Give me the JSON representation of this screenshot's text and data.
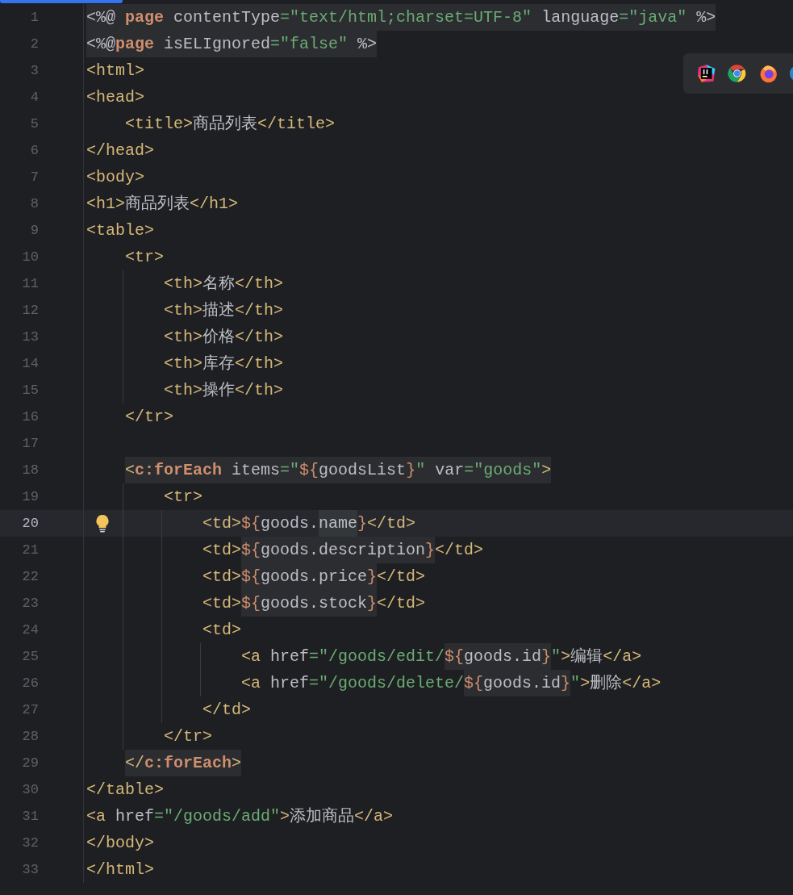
{
  "editor": {
    "lines": [
      {
        "n": "1",
        "selected": false,
        "segments": [
          {
            "kind": "block",
            "tokens": [
              {
                "kind": "plain",
                "text": "<%@ "
              },
              {
                "kind": "keyword",
                "text": "page"
              },
              {
                "kind": "plain",
                "text": " contentType"
              },
              {
                "kind": "string",
                "text": "=\"text/html;charset=UTF-8\""
              },
              {
                "kind": "plain",
                "text": " language"
              },
              {
                "kind": "string",
                "text": "=\"java\""
              },
              {
                "kind": "plain",
                "text": " %>"
              }
            ]
          }
        ]
      },
      {
        "n": "2",
        "selected": false,
        "segments": [
          {
            "kind": "block",
            "tokens": [
              {
                "kind": "plain",
                "text": "<%@"
              },
              {
                "kind": "keyword",
                "text": "page"
              },
              {
                "kind": "plain",
                "text": " isELIgnored"
              },
              {
                "kind": "string",
                "text": "=\"false\""
              },
              {
                "kind": "plain",
                "text": " %>"
              }
            ]
          }
        ]
      },
      {
        "n": "3",
        "selected": false,
        "segments": [
          {
            "kind": "plain",
            "tokens": [
              {
                "kind": "tag",
                "text": "<html>"
              }
            ]
          }
        ]
      },
      {
        "n": "4",
        "selected": false,
        "segments": [
          {
            "kind": "plain",
            "tokens": [
              {
                "kind": "tag",
                "text": "<head>"
              }
            ]
          }
        ],
        "children": [
          {
            "n": "5",
            "selected": false,
            "segments": [
              {
                "kind": "plain",
                "tokens": [
                  {
                    "kind": "tag",
                    "text": "<title>"
                  },
                  {
                    "kind": "plain",
                    "text": "商品列表"
                  },
                  {
                    "kind": "tag",
                    "text": "</title>"
                  }
                ]
              }
            ]
          }
        ]
      },
      {
        "n": "6",
        "selected": false,
        "segments": [
          {
            "kind": "plain",
            "tokens": [
              {
                "kind": "tag",
                "text": "</head>"
              }
            ]
          }
        ]
      },
      {
        "n": "7",
        "selected": false,
        "segments": [
          {
            "kind": "plain",
            "tokens": [
              {
                "kind": "tag",
                "text": "<body>"
              }
            ]
          }
        ]
      },
      {
        "n": "8",
        "selected": false,
        "segments": [
          {
            "kind": "plain",
            "tokens": [
              {
                "kind": "tag",
                "text": "<h1>"
              },
              {
                "kind": "plain",
                "text": "商品列表"
              },
              {
                "kind": "tag",
                "text": "</h1>"
              }
            ]
          }
        ]
      },
      {
        "n": "9",
        "selected": false,
        "segments": [
          {
            "kind": "plain",
            "tokens": [
              {
                "kind": "tag",
                "text": "<table>"
              }
            ]
          }
        ],
        "children": [
          {
            "n": "10",
            "selected": false,
            "segments": [
              {
                "kind": "plain",
                "tokens": [
                  {
                    "kind": "tag",
                    "text": "<tr>"
                  }
                ]
              }
            ],
            "children": [
              {
                "n": "11",
                "selected": false,
                "segments": [
                  {
                    "kind": "plain",
                    "tokens": [
                      {
                        "kind": "tag",
                        "text": "<th>"
                      },
                      {
                        "kind": "plain",
                        "text": "名称"
                      },
                      {
                        "kind": "tag",
                        "text": "</th>"
                      }
                    ]
                  }
                ]
              },
              {
                "n": "12",
                "selected": false,
                "segments": [
                  {
                    "kind": "plain",
                    "tokens": [
                      {
                        "kind": "tag",
                        "text": "<th>"
                      },
                      {
                        "kind": "plain",
                        "text": "描述"
                      },
                      {
                        "kind": "tag",
                        "text": "</th>"
                      }
                    ]
                  }
                ]
              },
              {
                "n": "13",
                "selected": false,
                "segments": [
                  {
                    "kind": "plain",
                    "tokens": [
                      {
                        "kind": "tag",
                        "text": "<th>"
                      },
                      {
                        "kind": "plain",
                        "text": "价格"
                      },
                      {
                        "kind": "tag",
                        "text": "</th>"
                      }
                    ]
                  }
                ]
              },
              {
                "n": "14",
                "selected": false,
                "segments": [
                  {
                    "kind": "plain",
                    "tokens": [
                      {
                        "kind": "tag",
                        "text": "<th>"
                      },
                      {
                        "kind": "plain",
                        "text": "库存"
                      },
                      {
                        "kind": "tag",
                        "text": "</th>"
                      }
                    ]
                  }
                ]
              },
              {
                "n": "15",
                "selected": false,
                "segments": [
                  {
                    "kind": "plain",
                    "tokens": [
                      {
                        "kind": "tag",
                        "text": "<th>"
                      },
                      {
                        "kind": "plain",
                        "text": "操作"
                      },
                      {
                        "kind": "tag",
                        "text": "</th>"
                      }
                    ]
                  }
                ]
              }
            ]
          },
          {
            "n": "16",
            "selected": false,
            "segments": [
              {
                "kind": "plain",
                "tokens": [
                  {
                    "kind": "tag",
                    "text": "</tr>"
                  }
                ]
              }
            ]
          },
          {
            "n": "17",
            "selected": false
          },
          {
            "n": "18",
            "selected": false,
            "segments": [
              {
                "kind": "block",
                "tokens": [
                  {
                    "kind": "tag",
                    "text": "<"
                  },
                  {
                    "kind": "keyword",
                    "text": "c:forEach"
                  },
                  {
                    "kind": "plain",
                    "text": " items"
                  },
                  {
                    "kind": "string",
                    "text": "=\""
                  },
                  {
                    "kind": "el",
                    "text": "${"
                  },
                  {
                    "kind": "plain",
                    "text": "goodsList"
                  },
                  {
                    "kind": "el",
                    "text": "}"
                  },
                  {
                    "kind": "string",
                    "text": "\""
                  },
                  {
                    "kind": "plain",
                    "text": " var"
                  },
                  {
                    "kind": "string",
                    "text": "=\"goods\""
                  },
                  {
                    "kind": "tag",
                    "text": ">"
                  }
                ]
              }
            ],
            "children": [
              {
                "n": "19",
                "selected": false,
                "segments": [
                  {
                    "kind": "plain",
                    "tokens": [
                      {
                        "kind": "tag",
                        "text": "<tr>"
                      }
                    ]
                  }
                ],
                "children": [
                  {
                    "n": "20",
                    "selected": true,
                    "segments": [
                      {
                        "kind": "plain",
                        "tokens": [
                          {
                            "kind": "tag",
                            "text": "<td>"
                          },
                          {
                            "kind": "el",
                            "text": "${"
                          },
                          {
                            "kind": "plain",
                            "text": "goods."
                          }
                        ]
                      },
                      {
                        "kind": "word",
                        "tokens": [
                          {
                            "kind": "plain",
                            "text": "name"
                          }
                        ]
                      },
                      {
                        "kind": "plain",
                        "tokens": [
                          {
                            "kind": "el",
                            "text": "}"
                          },
                          {
                            "kind": "tag",
                            "text": "</td>"
                          }
                        ]
                      }
                    ]
                  },
                  {
                    "n": "21",
                    "selected": false,
                    "segments": [
                      {
                        "kind": "plain",
                        "tokens": [
                          {
                            "kind": "tag",
                            "text": "<td>"
                          }
                        ]
                      },
                      {
                        "kind": "block",
                        "tokens": [
                          {
                            "kind": "el",
                            "text": "${"
                          },
                          {
                            "kind": "plain",
                            "text": "goods.description"
                          },
                          {
                            "kind": "el",
                            "text": "}"
                          }
                        ]
                      },
                      {
                        "kind": "plain",
                        "tokens": [
                          {
                            "kind": "tag",
                            "text": "</td>"
                          }
                        ]
                      }
                    ]
                  },
                  {
                    "n": "22",
                    "selected": false,
                    "segments": [
                      {
                        "kind": "plain",
                        "tokens": [
                          {
                            "kind": "tag",
                            "text": "<td>"
                          }
                        ]
                      },
                      {
                        "kind": "block",
                        "tokens": [
                          {
                            "kind": "el",
                            "text": "${"
                          },
                          {
                            "kind": "plain",
                            "text": "goods.price"
                          },
                          {
                            "kind": "el",
                            "text": "}"
                          }
                        ]
                      },
                      {
                        "kind": "plain",
                        "tokens": [
                          {
                            "kind": "tag",
                            "text": "</td>"
                          }
                        ]
                      }
                    ]
                  },
                  {
                    "n": "23",
                    "selected": false,
                    "segments": [
                      {
                        "kind": "plain",
                        "tokens": [
                          {
                            "kind": "tag",
                            "text": "<td>"
                          }
                        ]
                      },
                      {
                        "kind": "block",
                        "tokens": [
                          {
                            "kind": "el",
                            "text": "${"
                          },
                          {
                            "kind": "plain",
                            "text": "goods.stock"
                          },
                          {
                            "kind": "el",
                            "text": "}"
                          }
                        ]
                      },
                      {
                        "kind": "plain",
                        "tokens": [
                          {
                            "kind": "tag",
                            "text": "</td>"
                          }
                        ]
                      }
                    ]
                  },
                  {
                    "n": "24",
                    "selected": false,
                    "segments": [
                      {
                        "kind": "plain",
                        "tokens": [
                          {
                            "kind": "tag",
                            "text": "<td>"
                          }
                        ]
                      }
                    ],
                    "children": [
                      {
                        "n": "25",
                        "selected": false,
                        "segments": [
                          {
                            "kind": "plain",
                            "tokens": [
                              {
                                "kind": "tag",
                                "text": "<a"
                              },
                              {
                                "kind": "plain",
                                "text": " href"
                              },
                              {
                                "kind": "string",
                                "text": "=\"/goods/edit/"
                              }
                            ]
                          },
                          {
                            "kind": "block",
                            "tokens": [
                              {
                                "kind": "el",
                                "text": "${"
                              },
                              {
                                "kind": "plain",
                                "text": "goods.id"
                              },
                              {
                                "kind": "el",
                                "text": "}"
                              }
                            ]
                          },
                          {
                            "kind": "plain",
                            "tokens": [
                              {
                                "kind": "string",
                                "text": "\""
                              },
                              {
                                "kind": "tag",
                                "text": ">"
                              },
                              {
                                "kind": "plain",
                                "text": "编辑"
                              },
                              {
                                "kind": "tag",
                                "text": "</a>"
                              }
                            ]
                          }
                        ]
                      },
                      {
                        "n": "26",
                        "selected": false,
                        "segments": [
                          {
                            "kind": "plain",
                            "tokens": [
                              {
                                "kind": "tag",
                                "text": "<a"
                              },
                              {
                                "kind": "plain",
                                "text": " href"
                              },
                              {
                                "kind": "string",
                                "text": "=\"/goods/delete/"
                              }
                            ]
                          },
                          {
                            "kind": "block",
                            "tokens": [
                              {
                                "kind": "el",
                                "text": "${"
                              },
                              {
                                "kind": "plain",
                                "text": "goods.id"
                              },
                              {
                                "kind": "el",
                                "text": "}"
                              }
                            ]
                          },
                          {
                            "kind": "plain",
                            "tokens": [
                              {
                                "kind": "string",
                                "text": "\""
                              },
                              {
                                "kind": "tag",
                                "text": ">"
                              },
                              {
                                "kind": "plain",
                                "text": "删除"
                              },
                              {
                                "kind": "tag",
                                "text": "</a>"
                              }
                            ]
                          }
                        ]
                      }
                    ]
                  },
                  {
                    "n": "27",
                    "selected": false,
                    "segments": [
                      {
                        "kind": "plain",
                        "tokens": [
                          {
                            "kind": "tag",
                            "text": "</td>"
                          }
                        ]
                      }
                    ]
                  }
                ]
              },
              {
                "n": "28",
                "selected": false,
                "segments": [
                  {
                    "kind": "plain",
                    "tokens": [
                      {
                        "kind": "tag",
                        "text": "</tr>"
                      }
                    ]
                  }
                ]
              }
            ]
          },
          {
            "n": "29",
            "selected": false,
            "segments": [
              {
                "kind": "block",
                "tokens": [
                  {
                    "kind": "tag",
                    "text": "</"
                  },
                  {
                    "kind": "keyword",
                    "text": "c:forEach"
                  },
                  {
                    "kind": "tag",
                    "text": ">"
                  }
                ]
              }
            ]
          }
        ]
      },
      {
        "n": "30",
        "selected": false,
        "segments": [
          {
            "kind": "plain",
            "tokens": [
              {
                "kind": "tag",
                "text": "</table>"
              }
            ]
          }
        ]
      },
      {
        "n": "31",
        "selected": false,
        "segments": [
          {
            "kind": "plain",
            "tokens": [
              {
                "kind": "tag",
                "text": "<a"
              },
              {
                "kind": "plain",
                "text": " href"
              },
              {
                "kind": "string",
                "text": "=\"/goods/add\""
              },
              {
                "kind": "tag",
                "text": ">"
              },
              {
                "kind": "plain",
                "text": "添加商品"
              },
              {
                "kind": "tag",
                "text": "</a>"
              }
            ]
          }
        ]
      },
      {
        "n": "32",
        "selected": false,
        "segments": [
          {
            "kind": "plain",
            "tokens": [
              {
                "kind": "tag",
                "text": "</body>"
              }
            ]
          }
        ]
      },
      {
        "n": "33",
        "selected": false,
        "segments": [
          {
            "kind": "plain",
            "tokens": [
              {
                "kind": "tag",
                "text": "</html>"
              }
            ]
          }
        ]
      }
    ]
  }
}
